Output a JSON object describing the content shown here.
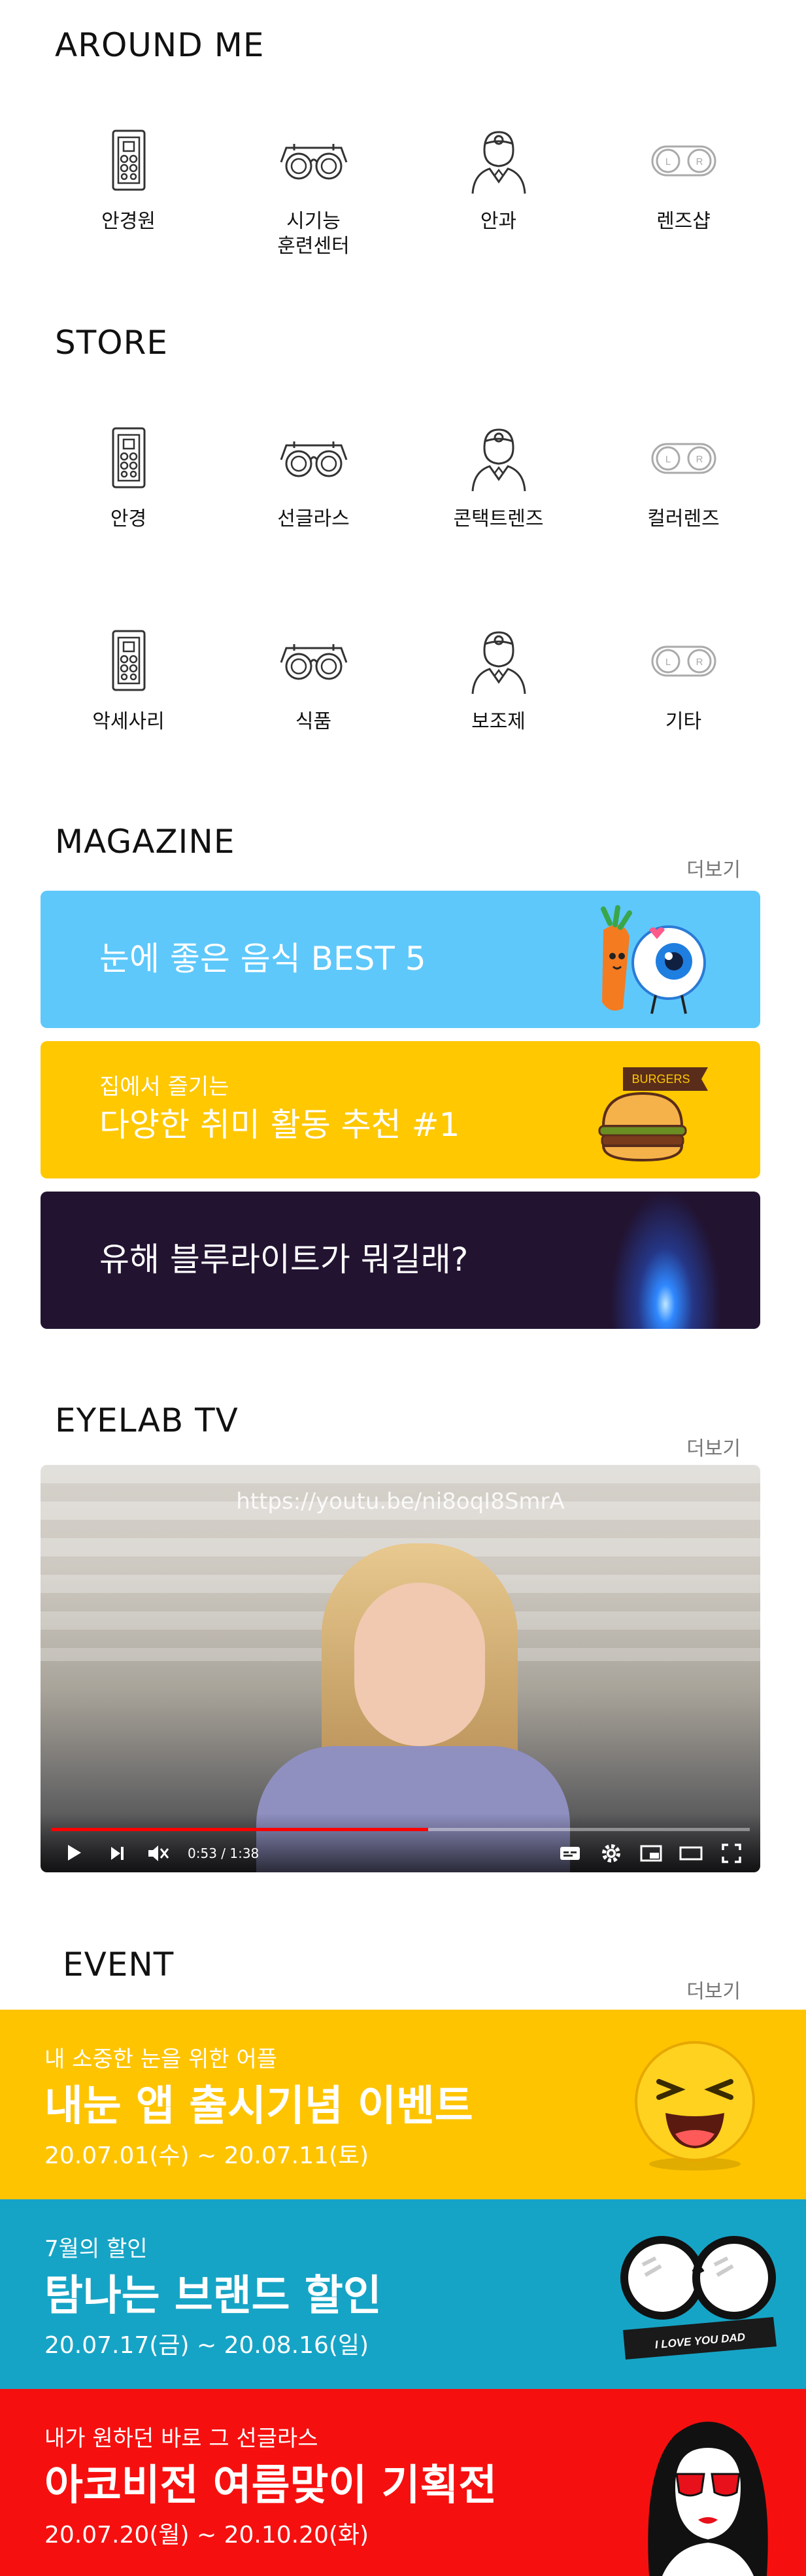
{
  "around_me": {
    "title": "AROUND ME",
    "items": [
      {
        "label": "안경원",
        "icon": "eye-chart-icon"
      },
      {
        "label": "시기능\n훈련센터",
        "icon": "trial-frame-icon"
      },
      {
        "label": "안과",
        "icon": "doctor-icon"
      },
      {
        "label": "렌즈샵",
        "icon": "lens-case-icon"
      }
    ]
  },
  "store": {
    "title": "STORE",
    "items": [
      {
        "label": "안경",
        "icon": "eye-chart-icon"
      },
      {
        "label": "선글라스",
        "icon": "trial-frame-icon"
      },
      {
        "label": "콘택트렌즈",
        "icon": "doctor-icon"
      },
      {
        "label": "컬러렌즈",
        "icon": "lens-case-icon"
      },
      {
        "label": "악세사리",
        "icon": "eye-chart-icon"
      },
      {
        "label": "식품",
        "icon": "trial-frame-icon"
      },
      {
        "label": "보조제",
        "icon": "doctor-icon"
      },
      {
        "label": "기타",
        "icon": "lens-case-icon"
      }
    ]
  },
  "magazine": {
    "title": "MAGAZINE",
    "more": "더보기",
    "banners": [
      {
        "text": "눈에 좋은 음식 BEST 5",
        "bg": "#5ec8fb",
        "icon": "carrot-eyeball-icon"
      },
      {
        "sub": "집에서 즐기는",
        "text": "다양한 취미 활동 추천 #1",
        "bg": "#ffc800",
        "icon": "burger-icon",
        "badge": "BURGERS"
      },
      {
        "text": "유해 블루라이트가 뭐길래?",
        "bg": "#221331",
        "icon": "blue-light-icon"
      }
    ]
  },
  "eyelab_tv": {
    "title": "EYELAB TV",
    "more": "더보기",
    "url": "https://youtu.be/ni8oqI8SmrA",
    "time": "0:53 / 1:38",
    "progress": 0.54
  },
  "event": {
    "title": "EVENT",
    "more": "더보기",
    "items": [
      {
        "sub": "내 소중한 눈을 위한 어플",
        "main": "내눈 앱 출시기념 이벤트",
        "date": "20.07.01(수) ~ 20.07.11(토)",
        "bg": "#ffc400",
        "icon": "laughing-emoji-icon"
      },
      {
        "sub": "7월의 할인",
        "main": "탐나는 브랜드 할인",
        "date": "20.07.17(금) ~ 20.08.16(일)",
        "bg": "#16a4c6",
        "icon": "glasses-ribbon-icon",
        "ribbon": "I LOVE YOU DAD"
      },
      {
        "sub": "내가 원하던 바로 그 선글라스",
        "main": "아코비전 여름맞이 기획전",
        "date": "20.07.20(월) ~ 20.10.20(화)",
        "bg": "#f5100f",
        "icon": "sunglasses-woman-icon"
      }
    ]
  }
}
